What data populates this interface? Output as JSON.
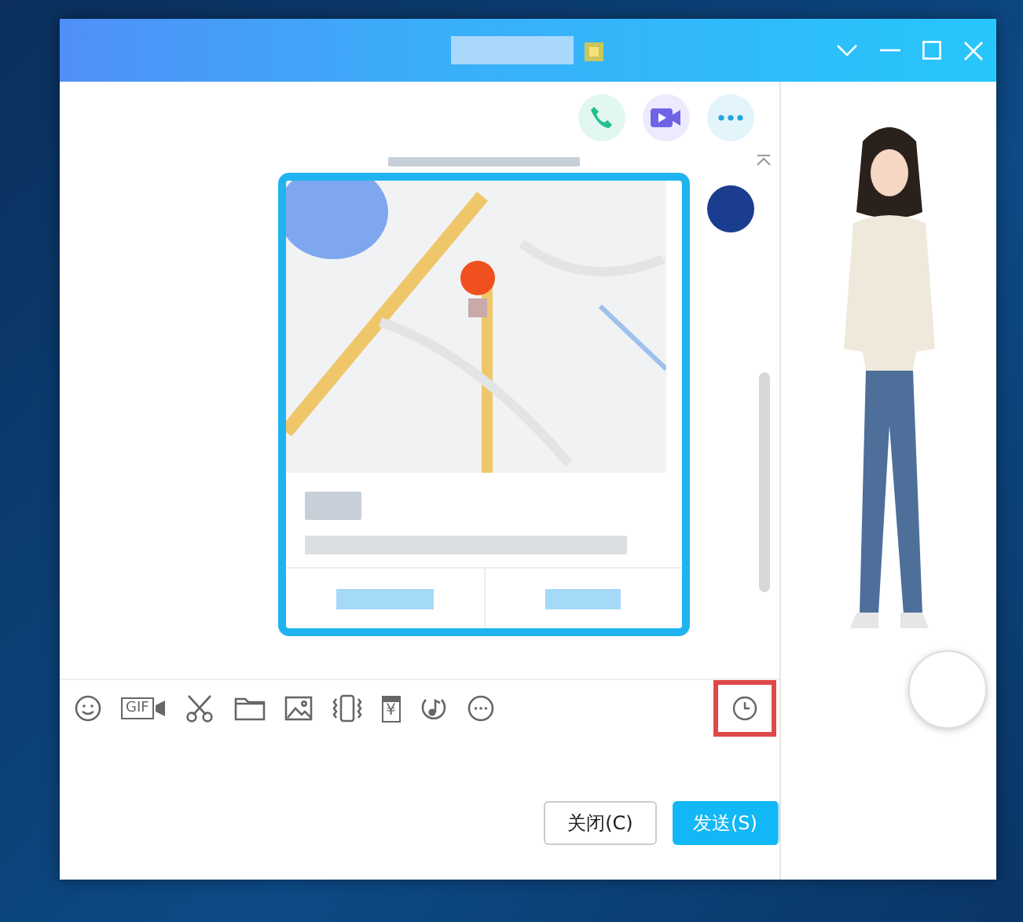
{
  "toolbar": {
    "items": [
      {
        "kind": "emoji"
      },
      {
        "kind": "gif",
        "label": "GIF"
      },
      {
        "kind": "scissors"
      },
      {
        "kind": "folder"
      },
      {
        "kind": "image"
      },
      {
        "kind": "shake"
      },
      {
        "kind": "red-packet",
        "label": "¥"
      },
      {
        "kind": "music"
      },
      {
        "kind": "more"
      }
    ],
    "history": {
      "highlighted": true
    }
  },
  "buttons": [
    {
      "kind": "close",
      "label": "关闭(C)"
    },
    {
      "kind": "send",
      "label": "发送(S)"
    }
  ]
}
